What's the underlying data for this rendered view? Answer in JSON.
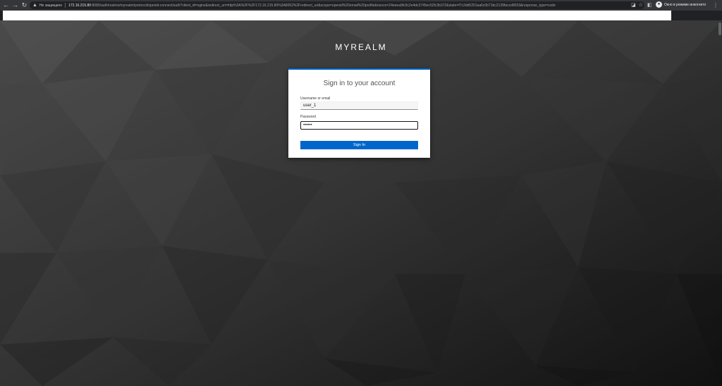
{
  "browser": {
    "security_label": "Не защищено",
    "url_host": "172.16.215.80",
    "url_path": ":8080/auth/realms/myrealm/protocol/openid-connect/auth?client_id=nginx&redirect_uri=http%3A%2F%2F172.16.215.80%3A8052%2Fredirect_uri&scope=openid%20email%20profile&nonce=24eeea9fc0c2e4dc3745ec52fc3b372&state=f7c2dd5201aa6c0b71bc2139faccd9033&response_type=code",
    "profile_label": "Окно в режиме инкогнито",
    "icons": [
      "back-arrow",
      "forward-arrow",
      "reload",
      "warning",
      "translate",
      "star",
      "sidebar",
      "incognito-avatar",
      "kebab-menu"
    ]
  },
  "page": {
    "realm_title": "MYREALM"
  },
  "login": {
    "heading": "Sign in to your account",
    "username_label": "Username or email",
    "username_value": "user_1",
    "password_label": "Password",
    "password_value": "••••••",
    "submit_label": "Sign In"
  },
  "colors": {
    "accent": "#0066cc",
    "chrome": "#35363a",
    "background": "#2b2b2b"
  }
}
